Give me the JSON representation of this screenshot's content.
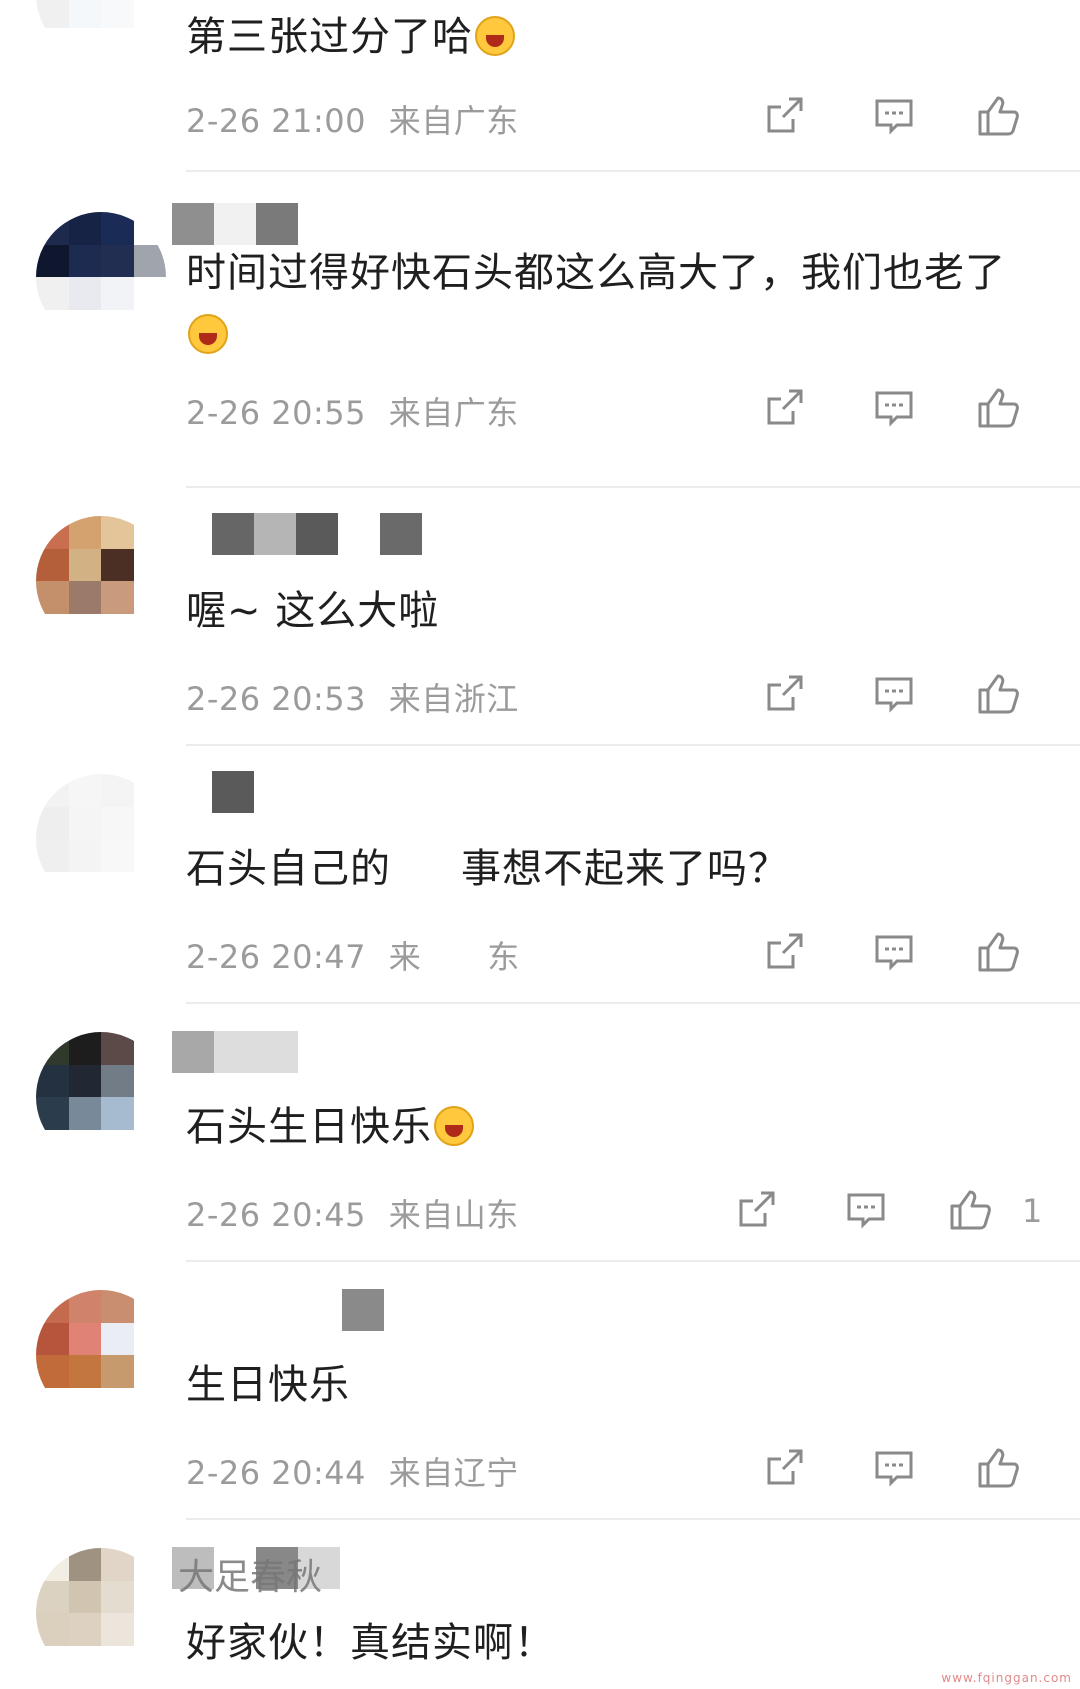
{
  "comments": [
    {
      "username": "",
      "text": "第三张过分了哈",
      "emoji": "grin-emoji",
      "time": "2-26 21:00",
      "location": "来自广东",
      "likes": ""
    },
    {
      "username": "",
      "text": "时间过得好快石头都这么高大了，我们也老了",
      "emoji": "laugh-cry-emoji",
      "time": "2-26 20:55",
      "location": "来自广东",
      "likes": ""
    },
    {
      "username": "",
      "text": "喔~ 这么大啦",
      "emoji": "",
      "time": "2-26 20:53",
      "location": "来自浙江",
      "likes": ""
    },
    {
      "username": "",
      "text": "石头自己的",
      "text_tail": "事想不起来了吗？",
      "emoji": "",
      "time": "2-26 20:47",
      "location": "来",
      "location_tail": "东",
      "likes": ""
    },
    {
      "username": "",
      "text": "石头生日快乐",
      "emoji": "party-emoji",
      "time": "2-26 20:45",
      "location": "来自山东",
      "likes": "1"
    },
    {
      "username": "",
      "text": "生日快乐",
      "emoji": "",
      "time": "2-26 20:44",
      "location": "来自辽宁",
      "likes": ""
    },
    {
      "username": "大足春秋",
      "text": "好家伙！真结实啊！",
      "emoji": "",
      "time": "",
      "location": "",
      "likes": ""
    }
  ],
  "icons": {
    "share": "share-icon",
    "comment": "comment-icon",
    "like": "thumbs-up-icon"
  },
  "colors": {
    "text": "#1f1f1f",
    "meta": "#9b9b9b",
    "icon": "#8a8a8a",
    "divider": "#ececec"
  },
  "watermark": "www.fqinggan.com"
}
